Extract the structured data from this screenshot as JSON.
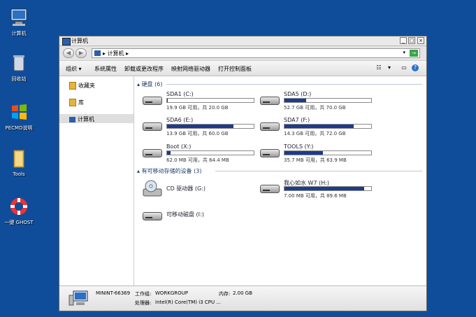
{
  "desktop": {
    "icons": [
      {
        "label": "计算机"
      },
      {
        "label": "回收站"
      },
      {
        "label": "PECMD说明"
      },
      {
        "label": "Tools"
      },
      {
        "label": "一键 GHOST"
      }
    ]
  },
  "window": {
    "title": "计算机",
    "minimize": "_",
    "maximize": "□",
    "close": "×",
    "address": "计算机",
    "address_prefix": "▸",
    "address_dropdown": "▾",
    "refresh": "→"
  },
  "toolbar": {
    "organize": "组织 ▾",
    "system_props": "系统属性",
    "uninstall": "卸载或更改程序",
    "map_drive": "映射网络驱动器",
    "control_panel": "打开控制面板"
  },
  "sidebar": {
    "favorites": "收藏夹",
    "libraries": "库",
    "computer": "计算机"
  },
  "sections": {
    "hdd": "硬盘 (6)",
    "removable": "有可移动存储的设备 (3)"
  },
  "drives": [
    {
      "name": "SDA1 (C:)",
      "info": "19.9 GB 可用，共 20.0 GB",
      "used": 0.005
    },
    {
      "name": "SDA5 (D:)",
      "info": "52.7 GB 可用，共 70.0 GB",
      "used": 0.25
    },
    {
      "name": "SDA6 (E:)",
      "info": "13.9 GB 可用，共 60.0 GB",
      "used": 0.77
    },
    {
      "name": "SDA7 (F:)",
      "info": "14.3 GB 可用，共 72.0 GB",
      "used": 0.8
    },
    {
      "name": "Boot (X:)",
      "info": "62.0 MB 可用，共 64.4 MB",
      "used": 0.04
    },
    {
      "name": "TOOLS (Y:)",
      "info": "35.7 MB 可用，共 63.9 MB",
      "used": 0.44
    }
  ],
  "removable": [
    {
      "name": "CD 驱动器 (G:)"
    },
    {
      "name": "我心如水 W7 (H:)",
      "info": "7.00 MB 可用，共 89.6 MB",
      "used": 0.92
    },
    {
      "name": "可移动磁盘 (I:)"
    }
  ],
  "status": {
    "computer_name": "MININT-66369",
    "workgroup_label": "工作组:",
    "workgroup": "WORKGROUP",
    "memory_label": "内存:",
    "memory": "2.00 GB",
    "cpu_label": "处理器:",
    "cpu": "Intel(R) Core(TM) i3 CPU ..."
  }
}
